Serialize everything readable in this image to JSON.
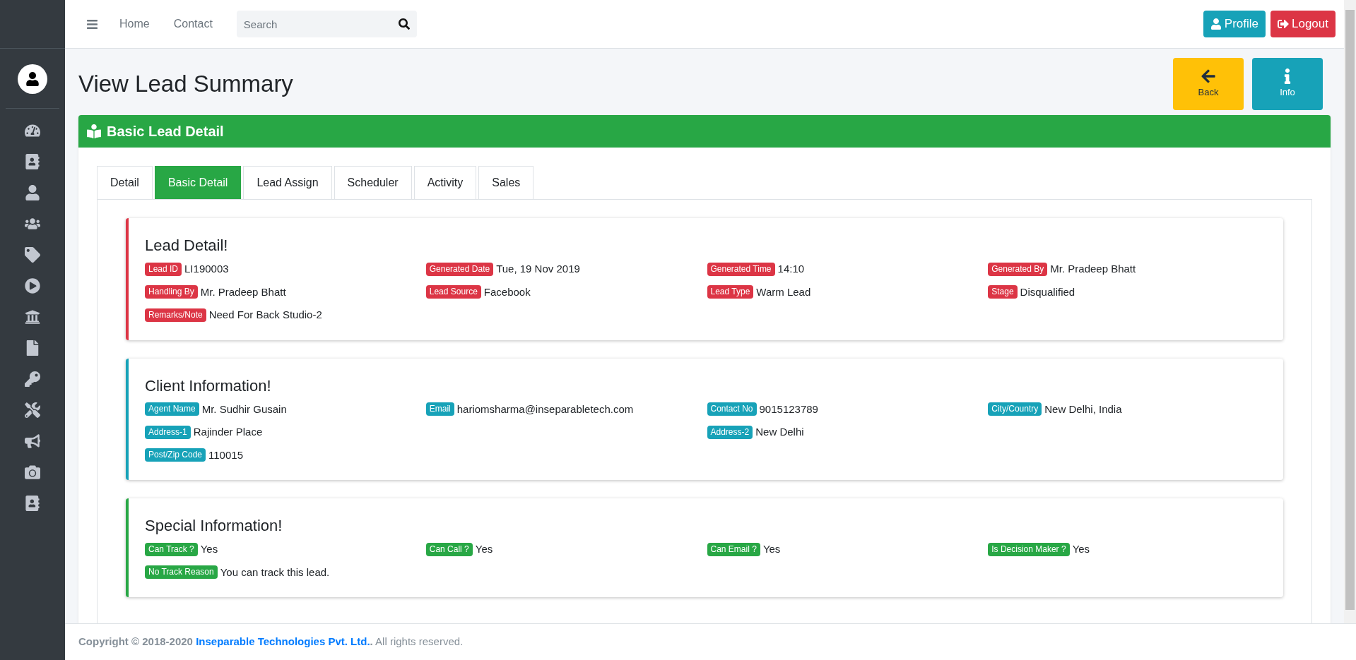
{
  "topbar": {
    "nav": [
      "Home",
      "Contact"
    ],
    "search": {
      "placeholder": "Search"
    },
    "buttons": [
      {
        "label": "Profile",
        "kind": "profile"
      },
      {
        "label": "Logout",
        "kind": "logout"
      }
    ]
  },
  "page": {
    "title": "View Lead Summary",
    "actions": [
      {
        "label": "Back",
        "kind": "back"
      },
      {
        "label": "Info",
        "kind": "info"
      }
    ]
  },
  "panel": {
    "title": "Basic Lead Detail",
    "tabs": [
      {
        "label": "Detail",
        "selected": false
      },
      {
        "label": "Basic Detail",
        "selected": true
      },
      {
        "label": "Lead Assign",
        "selected": false
      },
      {
        "label": "Scheduler",
        "selected": false
      },
      {
        "label": "Activity",
        "selected": false
      },
      {
        "label": "Sales",
        "selected": false
      }
    ],
    "sections": [
      {
        "title": "Lead Detail!",
        "color": "#dc3545",
        "rows": [
          [
            {
              "label": "Lead ID",
              "value": "LI190003"
            },
            {
              "label": "Generated Date",
              "value": "Tue, 19 Nov 2019"
            },
            {
              "label": "Generated Time",
              "value": "14:10"
            },
            {
              "label": "Generated By",
              "value": "Mr. Pradeep Bhatt"
            }
          ],
          [
            {
              "label": "Handling By",
              "value": "Mr. Pradeep Bhatt"
            },
            {
              "label": "Lead Source",
              "value": "Facebook"
            },
            {
              "label": "Lead Type",
              "value": "Warm Lead"
            },
            {
              "label": "Stage",
              "value": "Disqualified"
            }
          ],
          [
            {
              "label": "Remarks/Note",
              "value": "Need For Back Studio-2"
            },
            null,
            null,
            null
          ]
        ]
      },
      {
        "title": "Client Information!",
        "color": "#17a2b8",
        "rows": [
          [
            {
              "label": "Agent Name",
              "value": "Mr. Sudhir Gusain"
            },
            {
              "label": "Email",
              "value": "hariomsharma@inseparabletech.com"
            },
            {
              "label": "Contact No",
              "value": "9015123789"
            },
            {
              "label": "City/Country",
              "value": "New Delhi, India"
            }
          ],
          [
            {
              "label": "Address-1",
              "value": "Rajinder Place"
            },
            null,
            {
              "label": "Address-2",
              "value": "New Delhi"
            },
            null
          ],
          [
            {
              "label": "Post/Zip Code",
              "value": "110015"
            },
            null,
            null,
            null
          ]
        ]
      },
      {
        "title": "Special Information!",
        "color": "#28a745",
        "rows": [
          [
            {
              "label": "Can Track ?",
              "value": "Yes"
            },
            {
              "label": "Can Call ?",
              "value": "Yes"
            },
            {
              "label": "Can Email ?",
              "value": "Yes"
            },
            {
              "label": "Is Decision Maker ?",
              "value": "Yes"
            }
          ],
          [
            {
              "label": "No Track Reason",
              "value": "You can track this lead."
            },
            null,
            null,
            null
          ]
        ]
      }
    ]
  },
  "footer": {
    "prefix": "Copyright © 2018-2020",
    "link": "Inseparable Technologies Pvt. Ltd.",
    "suffix": "**.** All rights reserved."
  }
}
